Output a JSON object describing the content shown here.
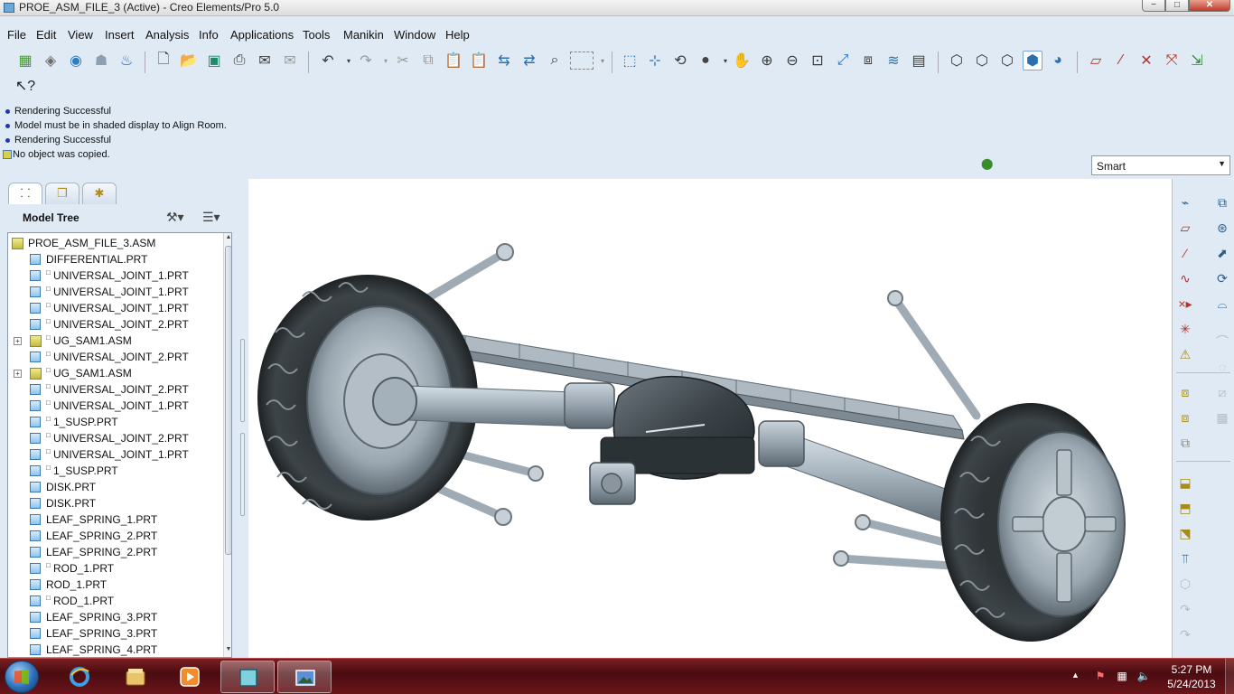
{
  "window": {
    "title": "PROE_ASM_FILE_3 (Active) - Creo Elements/Pro 5.0",
    "controls": {
      "minimize": "−",
      "maximize": "□",
      "close": "✕"
    }
  },
  "menubar": {
    "items": [
      "File",
      "Edit",
      "View",
      "Insert",
      "Analysis",
      "Info",
      "Applications",
      "Tools",
      "Manikin",
      "Window",
      "Help"
    ]
  },
  "toolbar": {
    "icons": [
      "display-settings-icon",
      "layers-icon",
      "datum-display-icon",
      "ergonomics-icon",
      "manikin-icon",
      "new-file-icon",
      "open-file-icon",
      "save-icon",
      "print-icon",
      "email-icon",
      "email-link-icon",
      "undo-icon",
      "redo-icon",
      "cut-icon",
      "copy-icon",
      "paste-icon",
      "paste-special-icon",
      "regenerate-icon",
      "regenerate-manager-icon",
      "find-icon",
      "select-box-icon",
      "repaint-icon",
      "spin-center-icon",
      "orient-mode-icon",
      "appearance-icon",
      "pan-icon",
      "zoom-in-icon",
      "zoom-out-icon",
      "refit-icon",
      "reorient-icon",
      "saved-views-icon",
      "layers-display-icon",
      "view-manager-icon",
      "wireframe-icon",
      "hidden-line-icon",
      "no-hidden-icon",
      "shading-icon",
      "enhanced-realism-icon",
      "datum-planes-icon",
      "datum-axes-icon",
      "datum-points-icon",
      "coordinate-systems-icon",
      "annotations-icon"
    ],
    "context_help_icon": "context-help-icon"
  },
  "messages": [
    {
      "text": "Rendering Successful",
      "type": "info"
    },
    {
      "text": "Model must be in shaded display to Align Room.",
      "type": "info"
    },
    {
      "text": "Rendering Successful",
      "type": "info"
    },
    {
      "text": "No object was copied.",
      "type": "warning"
    }
  ],
  "filter": {
    "value": "Smart"
  },
  "navigator": {
    "tabs": [
      "model-tree-tab",
      "folder-browser-tab",
      "favorites-tab"
    ],
    "model_tree_title": "Model Tree",
    "tree": [
      {
        "label": "PROE_ASM_FILE_3.ASM",
        "kind": "root-asm",
        "expandable": false,
        "marker": false
      },
      {
        "label": "DIFFERENTIAL.PRT",
        "kind": "prt",
        "expandable": false,
        "marker": false
      },
      {
        "label": "UNIVERSAL_JOINT_1.PRT",
        "kind": "prt",
        "expandable": false,
        "marker": true
      },
      {
        "label": "UNIVERSAL_JOINT_1.PRT",
        "kind": "prt",
        "expandable": false,
        "marker": true
      },
      {
        "label": "UNIVERSAL_JOINT_1.PRT",
        "kind": "prt",
        "expandable": false,
        "marker": true
      },
      {
        "label": "UNIVERSAL_JOINT_2.PRT",
        "kind": "prt",
        "expandable": false,
        "marker": true
      },
      {
        "label": "UG_SAM1.ASM",
        "kind": "asm",
        "expandable": true,
        "marker": true
      },
      {
        "label": "UNIVERSAL_JOINT_2.PRT",
        "kind": "prt",
        "expandable": false,
        "marker": true
      },
      {
        "label": "UG_SAM1.ASM",
        "kind": "asm",
        "expandable": true,
        "marker": true
      },
      {
        "label": "UNIVERSAL_JOINT_2.PRT",
        "kind": "prt",
        "expandable": false,
        "marker": true
      },
      {
        "label": "UNIVERSAL_JOINT_1.PRT",
        "kind": "prt",
        "expandable": false,
        "marker": true
      },
      {
        "label": "1_SUSP.PRT",
        "kind": "prt",
        "expandable": false,
        "marker": true
      },
      {
        "label": "UNIVERSAL_JOINT_2.PRT",
        "kind": "prt",
        "expandable": false,
        "marker": true
      },
      {
        "label": "UNIVERSAL_JOINT_1.PRT",
        "kind": "prt",
        "expandable": false,
        "marker": true
      },
      {
        "label": "1_SUSP.PRT",
        "kind": "prt",
        "expandable": false,
        "marker": true
      },
      {
        "label": "DISK.PRT",
        "kind": "prt",
        "expandable": false,
        "marker": false
      },
      {
        "label": "DISK.PRT",
        "kind": "prt",
        "expandable": false,
        "marker": false
      },
      {
        "label": "LEAF_SPRING_1.PRT",
        "kind": "prt",
        "expandable": false,
        "marker": false
      },
      {
        "label": "LEAF_SPRING_2.PRT",
        "kind": "prt",
        "expandable": false,
        "marker": false
      },
      {
        "label": "LEAF_SPRING_2.PRT",
        "kind": "prt",
        "expandable": false,
        "marker": false
      },
      {
        "label": "ROD_1.PRT",
        "kind": "prt",
        "expandable": false,
        "marker": true
      },
      {
        "label": "ROD_1.PRT",
        "kind": "prt",
        "expandable": false,
        "marker": false
      },
      {
        "label": "ROD_1.PRT",
        "kind": "prt",
        "expandable": false,
        "marker": true
      },
      {
        "label": "LEAF_SPRING_3.PRT",
        "kind": "prt",
        "expandable": false,
        "marker": false
      },
      {
        "label": "LEAF_SPRING_3.PRT",
        "kind": "prt",
        "expandable": false,
        "marker": false
      },
      {
        "label": "LEAF_SPRING_4.PRT",
        "kind": "prt",
        "expandable": false,
        "marker": false
      }
    ]
  },
  "right_toolbar": {
    "icons": [
      "sketch-tool-icon",
      "datum-plane-icon",
      "datum-axis-icon",
      "datum-curve-icon",
      "datum-point-icon",
      "csys-icon",
      "analysis-feature-icon",
      "move-component-icon",
      "drag-component-icon",
      "hole-tool-icon",
      "extrude-icon",
      "revolve-icon",
      "sweep-icon",
      "round-icon",
      "pattern-icon",
      "mirror-icon",
      "assemble-icon",
      "create-component-icon",
      "package-icon",
      "cut-icon",
      "shell-icon",
      "draft-icon",
      "rib-icon"
    ]
  },
  "taskbar": {
    "apps": [
      "internet-explorer-icon",
      "file-explorer-icon",
      "media-player-icon",
      "creo-icon",
      "image-viewer-icon"
    ],
    "clock_time": "5:27 PM",
    "clock_date": "5/24/2013"
  },
  "colors": {
    "message_dot": "#1b3f9e",
    "taskbar": "#5a1216",
    "ui_bg": "#dfeaf4"
  }
}
